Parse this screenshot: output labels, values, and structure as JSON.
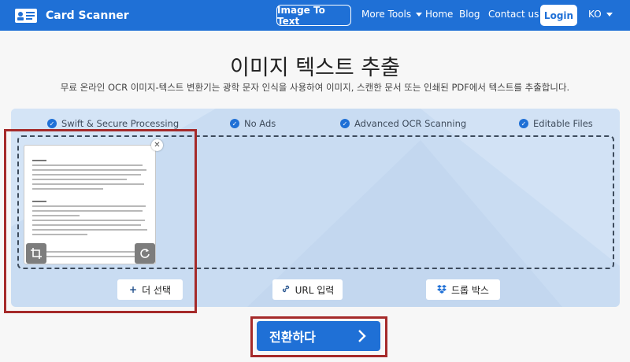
{
  "navbar": {
    "brand": "Card Scanner",
    "image_to_text": "Image To Text",
    "more_tools": "More Tools",
    "home": "Home",
    "blog": "Blog",
    "contact": "Contact us",
    "login": "Login",
    "language": "KO"
  },
  "hero": {
    "title": "이미지 텍스트 추출",
    "subtitle": "무료 온라인 OCR 이미지-텍스트 변환기는 광학 문자 인식을 사용하여 이미지, 스캔한 문서 또는 인쇄된 PDF에서 텍스트를 추출합니다."
  },
  "features": [
    "Swift & Secure Processing",
    "No Ads",
    "Advanced OCR Scanning",
    "Editable Files"
  ],
  "actions": {
    "more_select": "더 선택",
    "url_input": "URL 입력",
    "dropbox": "드롭 박스"
  },
  "convert_button": "전환하다",
  "colors": {
    "primary": "#1f70d6",
    "panel": "#c9dcf2",
    "highlight": "#a52a2a"
  },
  "icons": [
    "id-card-icon",
    "check-circle-icon",
    "close-icon",
    "crop-icon",
    "rotate-icon",
    "plus-icon",
    "link-icon",
    "dropbox-icon",
    "chevron-right-icon"
  ]
}
